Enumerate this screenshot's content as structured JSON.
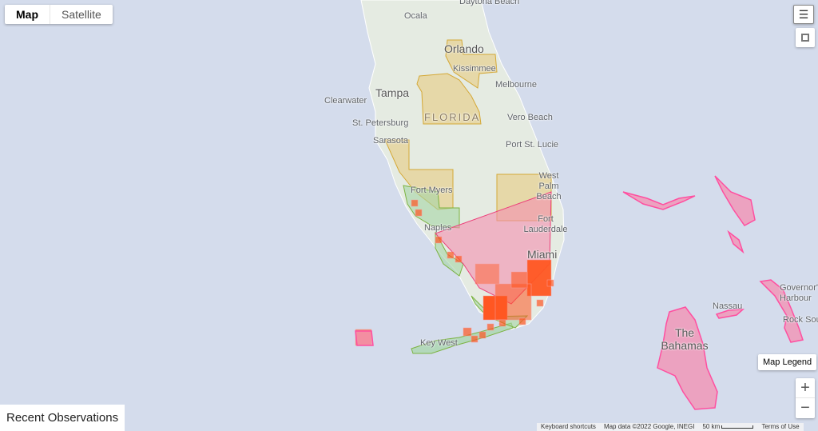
{
  "map_type": {
    "options": [
      "Map",
      "Satellite"
    ],
    "selected": "Map"
  },
  "labels": {
    "ocala": "Ocala",
    "daytona": "Daytona Beach",
    "orlando": "Orlando",
    "kissimmee": "Kissimmee",
    "melbourne": "Melbourne",
    "tampa": "Tampa",
    "clearwater": "Clearwater",
    "st_pete": "St. Petersburg",
    "florida": "FLORIDA",
    "vero": "Vero Beach",
    "port_st_lucie": "Port St. Lucie",
    "sarasota": "Sarasota",
    "west_palm": "West Palm Beach",
    "fort_myers": "Fort Myers",
    "fort_lauderdale": "Fort Lauderdale",
    "naples": "Naples",
    "miami": "Miami",
    "key_west": "Key West",
    "nassau": "Nassau",
    "bahamas": "The Bahamas",
    "governors": "Governor's Harbour",
    "rock_sound": "Rock Sound"
  },
  "controls": {
    "layers_icon": "layers-icon",
    "fullscreen_icon": "fullscreen-icon",
    "zoom_in": "+",
    "zoom_out": "−",
    "legend": "Map Legend"
  },
  "footer": {
    "shortcuts": "Keyboard shortcuts",
    "data": "Map data ©2022 Google, INEGI",
    "scale": "50 km",
    "terms": "Terms of Use"
  },
  "panel": {
    "recent": "Recent Observations"
  },
  "colors": {
    "water": "#d4dcec",
    "land": "#e8ece4",
    "yellow_region": "#e8c878",
    "pink_region": "#f48fb1",
    "red_cell": "#ff5722",
    "green_region": "#a5d6a7"
  }
}
